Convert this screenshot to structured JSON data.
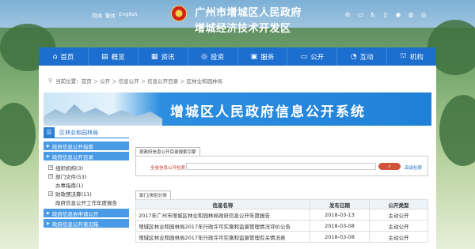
{
  "header": {
    "languages": [
      "简体",
      "繁体",
      "English"
    ],
    "title_line1": "广州市增城区人民政府",
    "title_line2": "增城经济技术开发区",
    "top_icons": [
      "wechat-icon",
      "screen-icon",
      "accessibility-icon",
      "phone-icon",
      "weibo-icon",
      "wechat-icon",
      "eye-icon"
    ]
  },
  "nav": [
    {
      "icon": "home-icon",
      "glyph": "⌂",
      "label": "首页"
    },
    {
      "icon": "overview-icon",
      "glyph": "▤",
      "label": "概览"
    },
    {
      "icon": "news-icon",
      "glyph": "▦",
      "label": "资讯"
    },
    {
      "icon": "invest-icon",
      "glyph": "◎",
      "label": "投资"
    },
    {
      "icon": "service-icon",
      "glyph": "▣",
      "label": "服务"
    },
    {
      "icon": "public-icon",
      "glyph": "▭",
      "label": "公开"
    },
    {
      "icon": "interact-icon",
      "glyph": "◔",
      "label": "互动"
    },
    {
      "icon": "org-icon",
      "glyph": "⛫",
      "label": "机构"
    }
  ],
  "breadcrumb": [
    "当前位置：首页",
    "＞",
    "公开",
    "＞",
    "信息公开",
    "＞",
    "信息公开目录",
    "＞",
    "区林业和园林局"
  ],
  "banner_title": "增城区人民政府信息公开系统",
  "sidebar": {
    "header": "区林业和园林局",
    "top_links": [
      "政府信息公开指南",
      "政府信息公开目录"
    ],
    "items": [
      {
        "label": "组织机构(3)",
        "box": true
      },
      {
        "label": "部门文件(53)",
        "box": true
      },
      {
        "label": "办事指南(1)",
        "box": false
      },
      {
        "label": "财政预决算(11)",
        "box": true
      },
      {
        "label": "政府信息公开工作年度报告",
        "box": false
      }
    ],
    "bottom_links": [
      "政府信息依申请公开",
      "政府信息公开意见箱"
    ]
  },
  "search": {
    "tab_label": "按政府信息公开目录搜索引擎",
    "field_label": "全省信息公开检索",
    "button_label": "",
    "advanced_label": "高级检索"
  },
  "dept_tab": "部门/类别分类",
  "table": {
    "headers": [
      "信息名称",
      "发布日期",
      "公开类型"
    ],
    "rows": [
      [
        "2017年广州市增城区林业和园林局政府信息公开年度报告",
        "2018-03-13",
        "主动公开"
      ],
      [
        "增城区林业和园林局2017年行政许可实施和监督管理情况评价公告",
        "2018-03-08",
        "主动公开"
      ],
      [
        "增城区林业和园林局2017年行政许可实施和监督管理有关情况表",
        "2018-03-08",
        "主动公开"
      ]
    ]
  }
}
